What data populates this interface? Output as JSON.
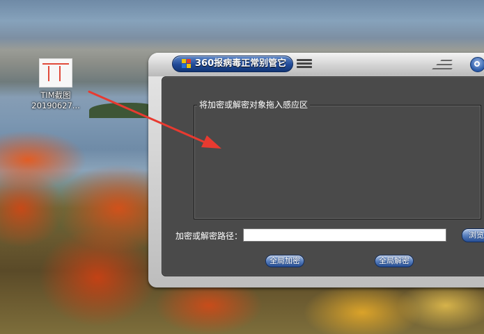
{
  "desktop": {
    "icon": {
      "name_line1": "TIM截图",
      "name_line2": "20190627..."
    }
  },
  "app": {
    "title": "360报病毒正常别管它",
    "drop_zone_label": "将加密或解密对象拖入感应区",
    "path_label": "加密或解密路径：",
    "path_value": "",
    "browse_label": "浏览",
    "encrypt_all_label": "全局加密",
    "decrypt_all_label": "全局解密"
  },
  "colors": {
    "panel": "#4a4a4a",
    "title_pill": "#214a97",
    "annotation_arrow": "#e83a30"
  }
}
